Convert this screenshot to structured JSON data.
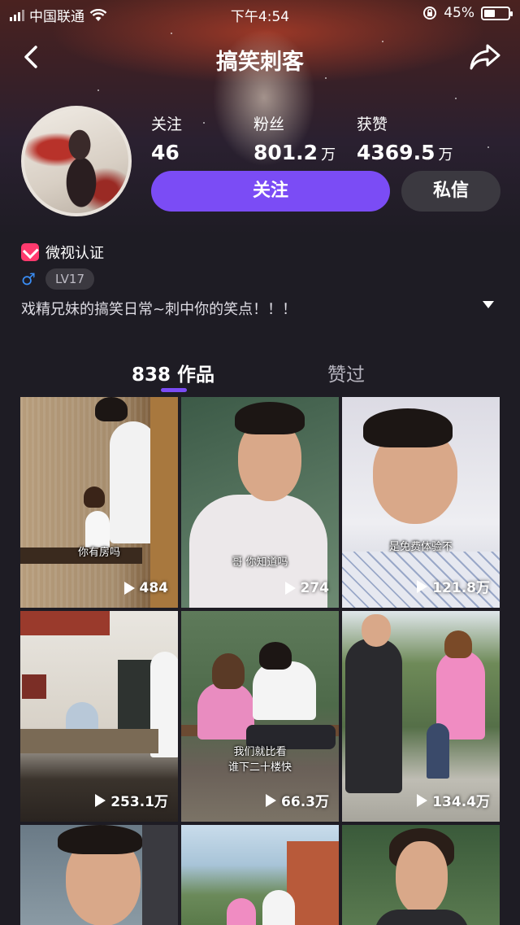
{
  "status_bar": {
    "carrier": "中国联通",
    "time": "下午4:54",
    "battery_percent": "45%",
    "battery_level": 0.45
  },
  "nav": {
    "title": "搞笑刺客",
    "back_icon": "chevron-left-icon",
    "share_icon": "share-icon"
  },
  "profile": {
    "stats": [
      {
        "label": "关注",
        "value": "46",
        "unit": ""
      },
      {
        "label": "粉丝",
        "value": "801.2",
        "unit": "万"
      },
      {
        "label": "获赞",
        "value": "4369.5",
        "unit": "万"
      }
    ],
    "follow_label": "关注",
    "message_label": "私信",
    "verified_label": "微视认证",
    "gender_symbol": "♂",
    "level": "LV17",
    "bio": "戏精兄妹的搞笑日常~刺中你的笑点！！！"
  },
  "tabs": {
    "works": "838 作品",
    "liked": "赞过"
  },
  "videos": [
    {
      "caption": "你有房吗",
      "plays": "484"
    },
    {
      "caption": "哥 你知道吗",
      "plays": "274"
    },
    {
      "caption": "是免费体验不",
      "plays": "121.8万"
    },
    {
      "caption": "",
      "plays": "253.1万"
    },
    {
      "caption_line1": "我们就比看",
      "caption_line2": "谁下二十楼快",
      "plays": "66.3万"
    },
    {
      "caption": "",
      "plays": "134.4万"
    },
    {
      "caption": "",
      "plays": ""
    },
    {
      "caption": "",
      "plays": ""
    },
    {
      "caption": "",
      "plays": ""
    }
  ],
  "colors": {
    "accent": "#7b4cf5",
    "background": "#1e1c24",
    "verified": "#ff3a6e",
    "gender": "#3a8df5"
  }
}
